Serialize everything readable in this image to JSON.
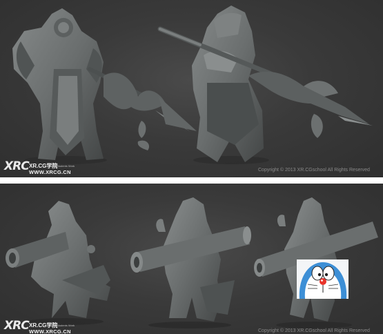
{
  "top_panel": {
    "logo": "XRC",
    "brand": "XR.CG学院",
    "brand_sub": "Students Work",
    "site": "WWW.XRCG.CN",
    "copyright": "Copyright © 2013  XR.CGschool All Rights  Reserved"
  },
  "bottom_panel": {
    "logo": "XRC",
    "brand": "XR.CG学院",
    "brand_sub": "Students Work",
    "site": "WWW.XRCG.CN",
    "copyright": "Copyright © 2013  XR.CGschool All Rights  Reserved"
  },
  "colors": {
    "background_top": "#3a3a3a",
    "background_bottom": "#333333",
    "sculpt": "#6f7373",
    "sculpt_shadow": "#2a2c2c",
    "divider": "#ffffff"
  },
  "overlay_character": "doraemon-face"
}
